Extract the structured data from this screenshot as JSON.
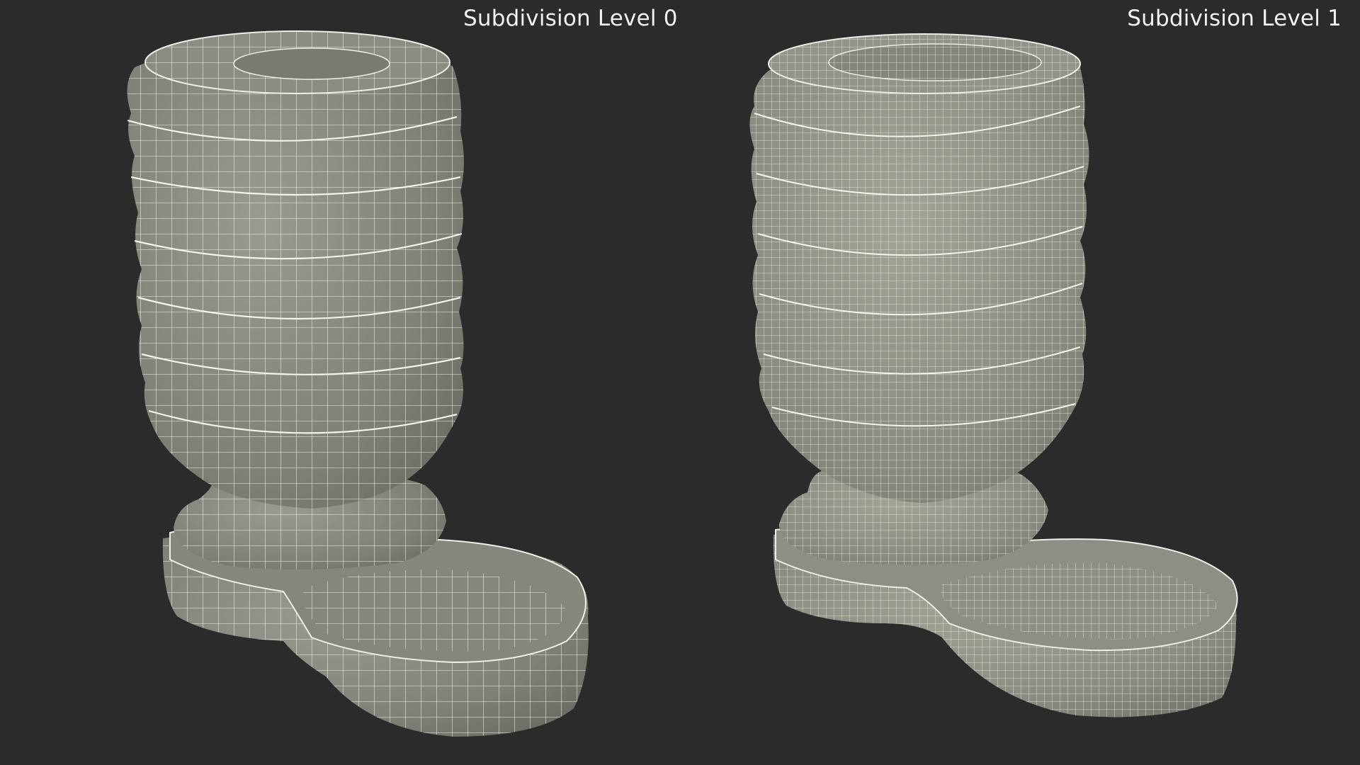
{
  "views": {
    "left": {
      "label": "Subdivision Level 0"
    },
    "right": {
      "label": "Subdivision Level 1"
    }
  },
  "colors": {
    "background": "#2b2b2b",
    "surface": "#8a8a80",
    "wire": "#eeeee6"
  }
}
